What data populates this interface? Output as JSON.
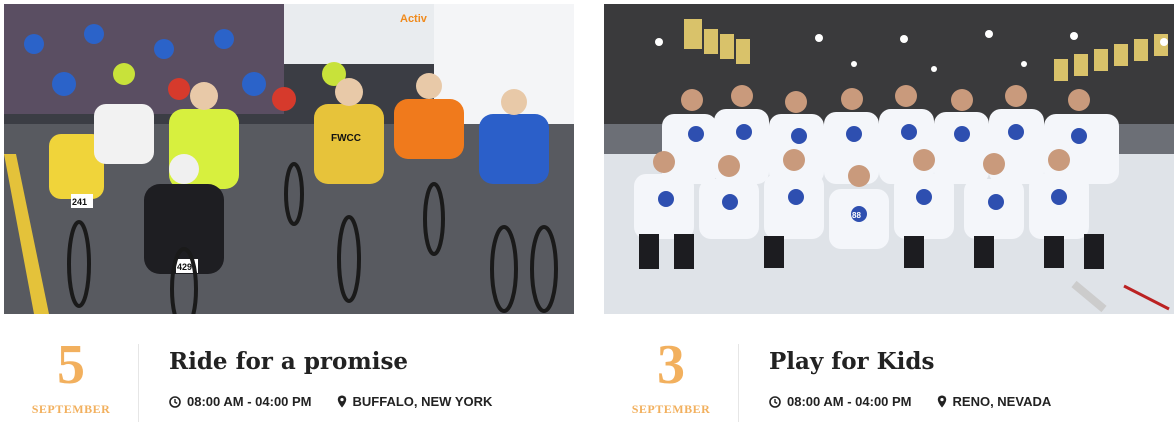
{
  "events": [
    {
      "day": "5",
      "month": "SEPTEMBER",
      "title": "Ride for a promise",
      "time": "08:00 AM - 04:00 PM",
      "location": "BUFFALO, NEW YORK",
      "photo": "cyclists-race-photo",
      "jersey_text": "FWCC",
      "bib_numbers": [
        "429",
        "241"
      ],
      "van_text": "Activ"
    },
    {
      "day": "3",
      "month": "SEPTEMBER",
      "title": "Play for Kids",
      "time": "08:00 AM - 04:00 PM",
      "location": "RENO, NEVADA",
      "photo": "hockey-team-photo",
      "jersey_text": "88"
    }
  ],
  "colors": {
    "accent": "#f2b05e",
    "title": "#222222",
    "divider": "#e6e6e6"
  },
  "icons": {
    "time": "clock-icon",
    "location": "map-pin-icon"
  }
}
